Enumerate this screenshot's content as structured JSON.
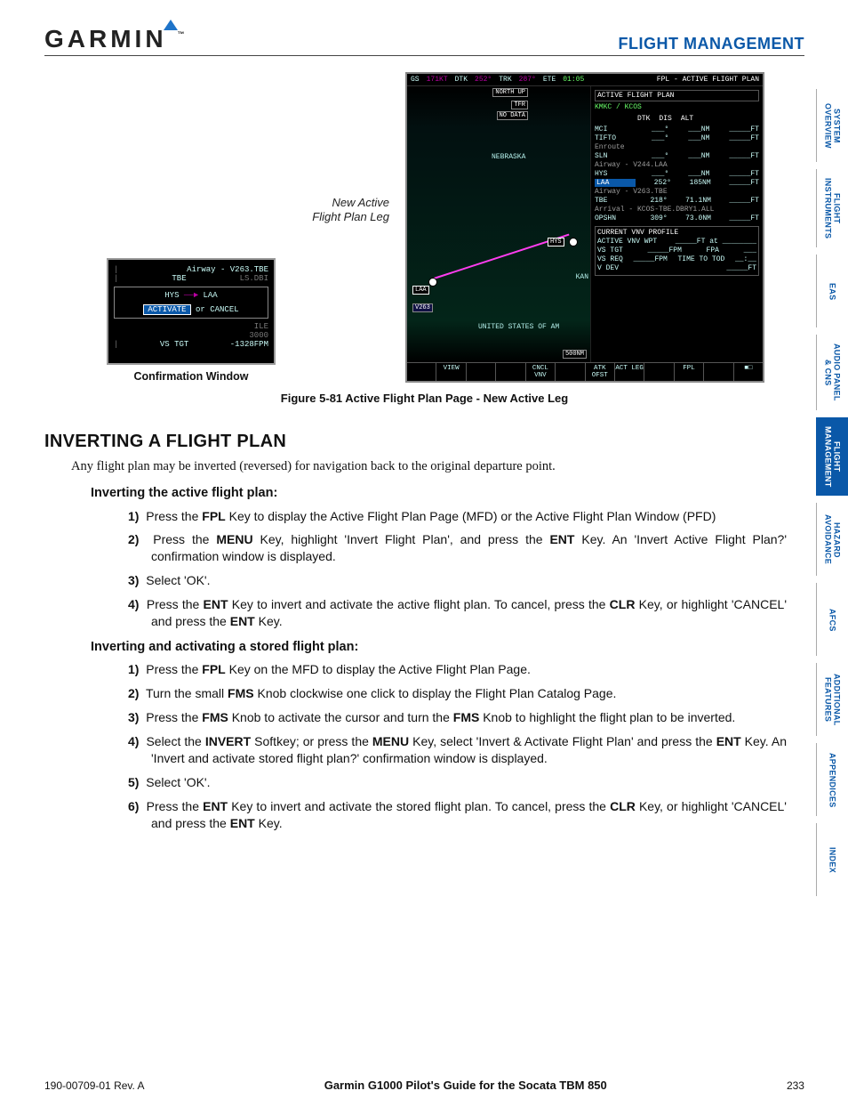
{
  "header": {
    "brand": "GARMIN",
    "chapter": "FLIGHT MANAGEMENT"
  },
  "tabs": [
    {
      "label": "SYSTEM\nOVERVIEW",
      "active": false
    },
    {
      "label": "FLIGHT\nINSTRUMENTS",
      "active": false
    },
    {
      "label": "EAS",
      "active": false
    },
    {
      "label": "AUDIO PANEL\n& CNS",
      "active": false
    },
    {
      "label": "FLIGHT\nMANAGEMENT",
      "active": true
    },
    {
      "label": "HAZARD\nAVOIDANCE",
      "active": false
    },
    {
      "label": "AFCS",
      "active": false
    },
    {
      "label": "ADDITIONAL\nFEATURES",
      "active": false
    },
    {
      "label": "APPENDICES",
      "active": false
    },
    {
      "label": "INDEX",
      "active": false
    }
  ],
  "confirmation": {
    "caption": "Confirmation Window",
    "airway": "Airway - V263.TBE",
    "dest": "TBE",
    "ls": "LS.DBI",
    "from": "HYS",
    "to": "LAA",
    "activate": "ACTIVATE",
    "or": "or",
    "cancel": "CANCEL",
    "ile": "ILE",
    "alt": "3000",
    "vs_lbl": "VS TGT",
    "vs_val": "-1328FPM"
  },
  "leg_label": "New Active\nFlight Plan Leg",
  "mfd": {
    "topbar": {
      "gs": "GS",
      "gsv": "171KT",
      "dtk": "DTK",
      "dtkv": "252°",
      "trk": "TRK",
      "trkv": "287°",
      "ete": "ETE",
      "etev": "01:05",
      "title": "FPL - ACTIVE FLIGHT PLAN"
    },
    "map": {
      "north": "NORTH UP",
      "tfr": "TFR",
      "nodata": "NO DATA",
      "neb": "NEBRASKA",
      "hys": "HYS",
      "laa": "LAA",
      "v263": "V263",
      "kan": "KAN",
      "usa": "UNITED STATES OF AM",
      "scale": "500NM"
    },
    "fpl": {
      "header": "ACTIVE FLIGHT PLAN",
      "plan": "KMKC / KCOS",
      "cols": [
        "DTK",
        "DIS",
        "ALT"
      ],
      "rows": [
        {
          "wp": "MCI",
          "dtk": "___°",
          "dis": "___NM",
          "alt": "_____FT"
        },
        {
          "wp": "TIFTO",
          "dtk": "___°",
          "dis": "___NM",
          "alt": "_____FT"
        },
        {
          "awy": "Enroute"
        },
        {
          "wp": "SLN",
          "dtk": "___°",
          "dis": "___NM",
          "alt": "_____FT"
        },
        {
          "awy": "Airway - V244.LAA"
        },
        {
          "wp": "HYS",
          "dtk": "___°",
          "dis": "___NM",
          "alt": "_____FT"
        },
        {
          "wp": "LAA",
          "dtk": "252°",
          "dis": "185NM",
          "alt": "_____FT",
          "hl": true
        },
        {
          "awy": "Airway - V263.TBE"
        },
        {
          "wp": "TBE",
          "dtk": "218°",
          "dis": "71.1NM",
          "alt": "_____FT"
        },
        {
          "awy": "Arrival - KCOS-TBE.DBRY1.ALL"
        },
        {
          "wp": "OPSHN",
          "dtk": "309°",
          "dis": "73.0NM",
          "alt": "_____FT"
        }
      ],
      "vnv": {
        "title": "CURRENT VNV PROFILE",
        "act": "ACTIVE VNV WPT",
        "actv": "_____FT  at  ________",
        "vstgt": "VS TGT",
        "vstgtv": "_____FPM",
        "fpa": "FPA",
        "fpav": "___",
        "vsreq": "VS REQ",
        "vsreqv": "_____FPM",
        "tod": "TIME TO TOD",
        "todv": "__:__",
        "vdev": "V DEV",
        "vdevv": "_____FT"
      }
    },
    "softkeys": [
      "",
      "VIEW",
      "",
      "",
      "CNCL VNV",
      "",
      "ATK OFST",
      "ACT LEG",
      "",
      "FPL",
      "",
      "■□"
    ]
  },
  "figcap": "Figure 5-81  Active Flight Plan Page - New Active Leg",
  "section": {
    "h": "INVERTING A FLIGHT PLAN",
    "lead": "Any flight plan may be inverted (reversed) for navigation back to the original departure point.",
    "p1_h": "Inverting the active flight plan:",
    "p1": [
      "Press the <b>FPL</b> Key to display the Active Flight Plan Page (MFD) or the Active Flight Plan Window (PFD)",
      "Press the <b>MENU</b> Key, highlight 'Invert Flight Plan', and press the <b>ENT</b> Key.  An 'Invert Active Flight Plan?' confirmation window is displayed.",
      "Select 'OK'.",
      "Press the <b>ENT</b> Key to invert and activate the active flight plan.  To cancel, press the <b>CLR</b> Key, or highlight 'CANCEL' and press the <b>ENT</b> Key."
    ],
    "p2_h": "Inverting and activating a stored flight plan:",
    "p2": [
      "Press the <b>FPL</b> Key on the MFD to display the Active Flight Plan Page.",
      "Turn the small <b>FMS</b> Knob clockwise one click to display the Flight Plan Catalog Page.",
      "Press the <b>FMS</b> Knob to activate the cursor and turn the <b>FMS</b> Knob to highlight the flight plan to be inverted.",
      "Select the <b>INVERT</b> Softkey; or press the <b>MENU</b> Key, select 'Invert & Activate Flight Plan' and press the <b>ENT</b> Key. An 'Invert and activate stored flight plan?' confirmation window is displayed.",
      "Select 'OK'.",
      "Press the <b>ENT</b> Key to invert and activate the stored flight plan.  To cancel, press the <b>CLR</b> Key, or highlight 'CANCEL' and press the <b>ENT</b> Key."
    ]
  },
  "footer": {
    "left": "190-00709-01  Rev. A",
    "mid": "Garmin G1000 Pilot's Guide for the Socata TBM 850",
    "right": "233"
  }
}
